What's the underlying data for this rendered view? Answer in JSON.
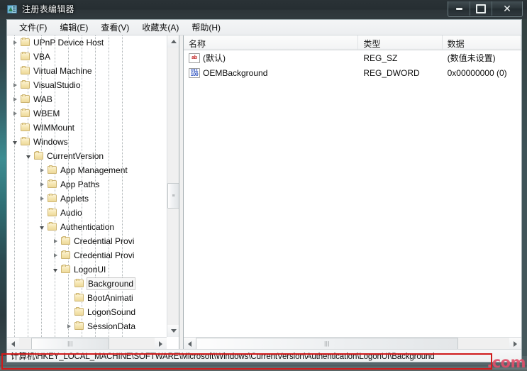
{
  "window": {
    "title": "注册表编辑器",
    "icon": "registry-editor-icon",
    "buttons": {
      "minimize": "最小化",
      "maximize": "最大化",
      "close": "关闭"
    }
  },
  "menubar": {
    "items": [
      {
        "label": "文件(F)",
        "name": "menu-file"
      },
      {
        "label": "编辑(E)",
        "name": "menu-edit"
      },
      {
        "label": "查看(V)",
        "name": "menu-view"
      },
      {
        "label": "收藏夹(A)",
        "name": "menu-favorites"
      },
      {
        "label": "帮助(H)",
        "name": "menu-help"
      }
    ]
  },
  "tree": {
    "rows": [
      {
        "label": "UPnP Device Host",
        "depth": 1,
        "state": "collapsed",
        "selected": false
      },
      {
        "label": "VBA",
        "depth": 1,
        "state": "leaf",
        "selected": false
      },
      {
        "label": "Virtual Machine",
        "depth": 1,
        "state": "leaf",
        "selected": false
      },
      {
        "label": "VisualStudio",
        "depth": 1,
        "state": "collapsed",
        "selected": false
      },
      {
        "label": "WAB",
        "depth": 1,
        "state": "collapsed",
        "selected": false
      },
      {
        "label": "WBEM",
        "depth": 1,
        "state": "collapsed",
        "selected": false
      },
      {
        "label": "WIMMount",
        "depth": 1,
        "state": "leaf",
        "selected": false
      },
      {
        "label": "Windows",
        "depth": 1,
        "state": "expanded",
        "selected": false
      },
      {
        "label": "CurrentVersion",
        "depth": 2,
        "state": "expanded",
        "selected": false
      },
      {
        "label": "App Management",
        "depth": 3,
        "state": "collapsed",
        "selected": false
      },
      {
        "label": "App Paths",
        "depth": 3,
        "state": "collapsed",
        "selected": false
      },
      {
        "label": "Applets",
        "depth": 3,
        "state": "collapsed",
        "selected": false
      },
      {
        "label": "Audio",
        "depth": 3,
        "state": "leaf",
        "selected": false
      },
      {
        "label": "Authentication",
        "depth": 3,
        "state": "expanded",
        "selected": false
      },
      {
        "label": "Credential Provi",
        "depth": 4,
        "state": "collapsed",
        "selected": false
      },
      {
        "label": "Credential Provi",
        "depth": 4,
        "state": "collapsed",
        "selected": false
      },
      {
        "label": "LogonUI",
        "depth": 4,
        "state": "expanded",
        "selected": false
      },
      {
        "label": "Background",
        "depth": 5,
        "state": "leaf",
        "selected": true
      },
      {
        "label": "BootAnimati",
        "depth": 5,
        "state": "leaf",
        "selected": false
      },
      {
        "label": "LogonSound",
        "depth": 5,
        "state": "leaf",
        "selected": false
      },
      {
        "label": "SessionData",
        "depth": 5,
        "state": "collapsed",
        "selected": false
      }
    ]
  },
  "list": {
    "headers": [
      {
        "label": "名称",
        "name": "column-header-name"
      },
      {
        "label": "类型",
        "name": "column-header-type"
      },
      {
        "label": "数据",
        "name": "column-header-data"
      }
    ],
    "rows": [
      {
        "icon": "string-value-icon",
        "icon_text": "ab",
        "name": "(默认)",
        "type": "REG_SZ",
        "data": "(数值未设置)"
      },
      {
        "icon": "dword-value-icon",
        "icon_top": "011",
        "icon_bottom": "100",
        "name": "OEMBackground",
        "type": "REG_DWORD",
        "data": "0x00000000 (0)"
      }
    ]
  },
  "statusbar": {
    "path": "计算机\\HKEY_LOCAL_MACHINE\\SOFTWARE\\Microsoft\\Windows\\CurrentVersion\\Authentication\\LogonUI\\Background"
  },
  "annotation": {
    "highlight_color": "#d01a1a",
    "watermark": ".com"
  },
  "colors": {
    "title_bar": "#2a3236",
    "glass_accent": "#3d8d92",
    "selection_border": "#cdcdcd",
    "folder": "#f6e7b4"
  }
}
